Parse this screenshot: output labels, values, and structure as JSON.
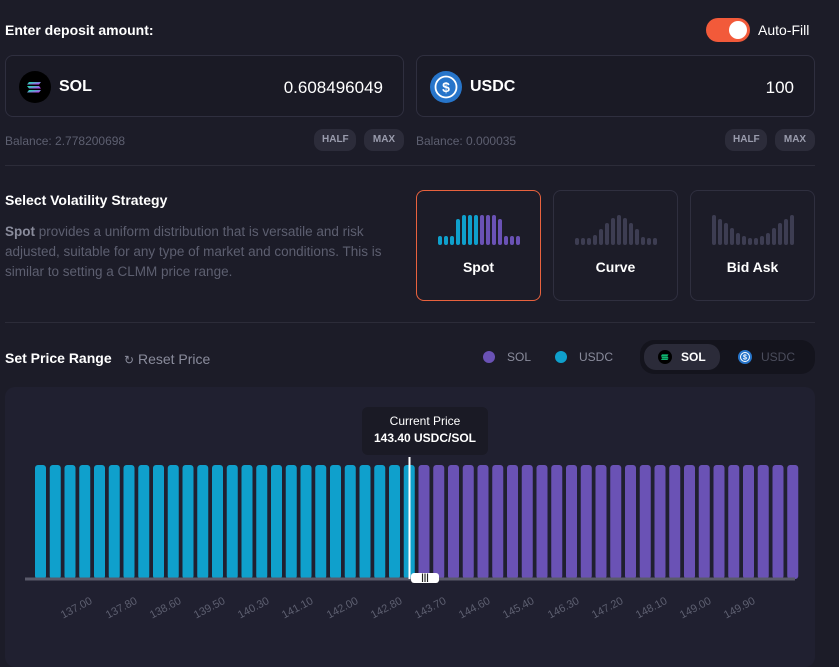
{
  "deposit": {
    "title": "Enter deposit amount:",
    "autofill_label": "Auto-Fill",
    "autofill_on": true,
    "token_a": {
      "symbol": "SOL",
      "amount": "0.608496049",
      "balance": "Balance: 2.778200698",
      "icon": "solana-logo-icon"
    },
    "token_b": {
      "symbol": "USDC",
      "amount": "100",
      "balance": "Balance: 0.000035",
      "icon": "usdc-logo-icon"
    },
    "half_label": "HALF",
    "max_label": "MAX"
  },
  "strategy": {
    "title": "Select Volatility Strategy",
    "desc_strong": "Spot",
    "desc_rest": " provides a uniform distribution that is versatile and risk adjusted, suitable for any type of market and conditions. This is similar to setting a CLMM price range.",
    "options": [
      {
        "label": "Spot",
        "selected": true
      },
      {
        "label": "Curve",
        "selected": false
      },
      {
        "label": "Bid Ask",
        "selected": false
      }
    ]
  },
  "price_range": {
    "title": "Set Price Range",
    "reset_label": "Reset Price",
    "legend": [
      {
        "label": "SOL",
        "color": "#6a52b5"
      },
      {
        "label": "USDC",
        "color": "#0fa0cc"
      }
    ],
    "toggle": {
      "left": "SOL",
      "right": "USDC",
      "active": "SOL"
    }
  },
  "chart_data": {
    "type": "bar",
    "tooltip_title": "Current Price",
    "tooltip_value": "143.40 USDC/SOL",
    "current_price": 143.4,
    "bin_count": 52,
    "bins_usdc": 26,
    "bins_sol": 26,
    "values": "uniform",
    "tick_labels": [
      "137.00",
      "137.80",
      "138.60",
      "139.50",
      "140.30",
      "141.10",
      "142.00",
      "142.80",
      "143.70",
      "144.60",
      "145.40",
      "146.30",
      "147.20",
      "148.10",
      "149.00",
      "149.90"
    ],
    "colors": {
      "usdc": "#0fa0cc",
      "sol": "#6a52b5"
    }
  }
}
